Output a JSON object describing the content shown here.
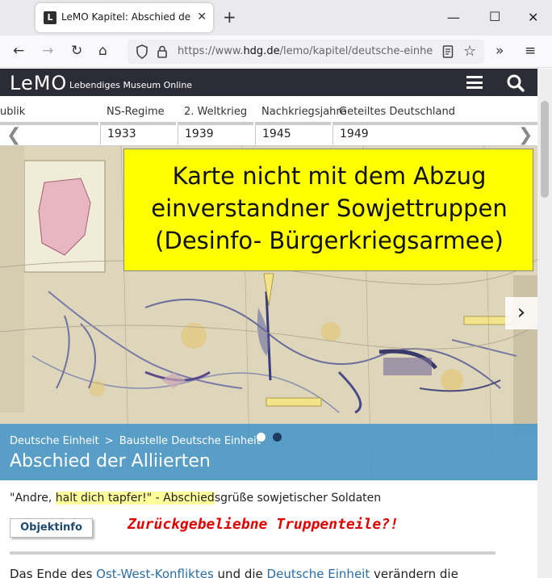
{
  "browser": {
    "tab_favicon": "L",
    "tab_title": "LeMO Kapitel: Abschied der Alliierten",
    "tab_close": "✕",
    "new_tab": "+",
    "url_prefix": "https://www.",
    "url_domain": "hdg.de",
    "url_path": "/lemo/kapitel/deutsche-einheit/b",
    "icons": [
      "back-arrow-icon",
      "forward-arrow-icon",
      "reload-icon",
      "home-icon",
      "shield-icon",
      "lock-icon",
      "reader-icon",
      "star-icon",
      "overflow-icon",
      "menu-icon"
    ]
  },
  "header": {
    "logo": "LeMO",
    "subtitle": "Lebendiges Museum Online"
  },
  "timeline": {
    "eras": [
      {
        "label": "ublik"
      },
      {
        "label": "NS-Regime"
      },
      {
        "label": "2. Weltkrieg"
      },
      {
        "label": "Nachkriegsjahre"
      },
      {
        "label": "Geteiltes Deutschland"
      }
    ],
    "years": [
      "1933",
      "1939",
      "1945",
      "1949"
    ]
  },
  "hero": {
    "overlay_lines": [
      "Karte nicht mit dem Abzug",
      "einverstandner Sowjettruppen",
      "(Desinfo- Bürgerkriegsarmee)"
    ],
    "breadcrumb_1": "Deutsche Einheit",
    "breadcrumb_sep": ">",
    "breadcrumb_2": "Baustelle Deutsche Einheit",
    "title": "Abschied der Alliierten",
    "next_label": "›"
  },
  "content": {
    "subtitle_1": "\"Andre, ",
    "subtitle_2": "halt dich tapfer!\" - Abschied",
    "subtitle_3": "sgrüße sowjetischer Soldaten",
    "objektinfo": "Objektinfo",
    "red_note": "Zurückgebeliebne Truppenteile?!",
    "body_1": "Das Ende des ",
    "body_link_1": "Ost-West-Konfliktes",
    "body_2": " und die ",
    "body_link_2": "Deutsche Einheit",
    "body_3": " verändern die"
  },
  "colors": {
    "header_bg": "#2c2c37",
    "caption_bg": "#4696c8",
    "overlay_yellow": "#ffff00",
    "note_red": "#e00000",
    "link": "#2a6ea6"
  }
}
